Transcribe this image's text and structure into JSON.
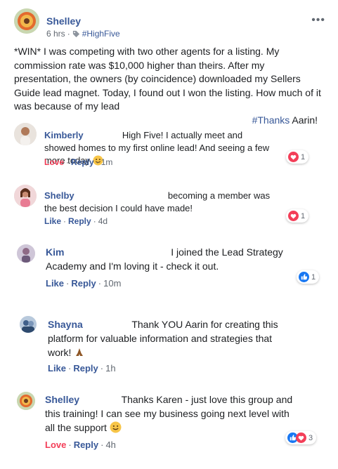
{
  "post": {
    "author": "Shelley",
    "time": "6 hrs",
    "separator": "·",
    "hashtag": "#HighFive",
    "body": "*WIN* I was competing with two other agents for a listing. My commission rate was $10,000 higher than theirs. After my presentation, the owners (by coincidence) downloaded my Sellers Guide lead magnet. Today, I found out I won the listing. How much of it was because of my lead",
    "thanks_tag": "#Thanks",
    "thanks_name": "Aarin!",
    "more_label": "•••"
  },
  "comments": [
    {
      "name": "Kimberly",
      "text": "High Five! I actually meet and showed homes to my first online lead! And seeing a few more today",
      "action1": "Love",
      "action2": "Reply",
      "time": "1m",
      "reaction_count": "1",
      "reaction": "love-icon"
    },
    {
      "name": "Shelby",
      "text": "becoming a member was the best decision I could have made!",
      "action1": "Like",
      "action2": "Reply",
      "time": "4d",
      "reaction_count": "1",
      "reaction": "love-icon"
    },
    {
      "name": "Kim",
      "text": "I joined the Lead Strategy Academy and I'm loving it - check it out.",
      "action1": "Like",
      "action2": "Reply",
      "time": "10m",
      "reaction_count": "1",
      "reaction": "like-icon"
    },
    {
      "name": "Shayna",
      "text": "Thank YOU Aarin for creating this platform for valuable information and strategies that work!",
      "action1": "Like",
      "action2": "Reply",
      "time": "1h"
    },
    {
      "name": "Shelley",
      "text": "Thanks Karen - just love this group and this training! I can see my business going next level with all the support",
      "action1": "Love",
      "action2": "Reply",
      "time": "4h",
      "reaction_count": "3",
      "reaction": "like-and-love-icons"
    }
  ],
  "colors": {
    "link": "#385898",
    "love": "#f33e58",
    "like": "#1877f2",
    "meta": "#606770",
    "text": "#1c1e21"
  }
}
